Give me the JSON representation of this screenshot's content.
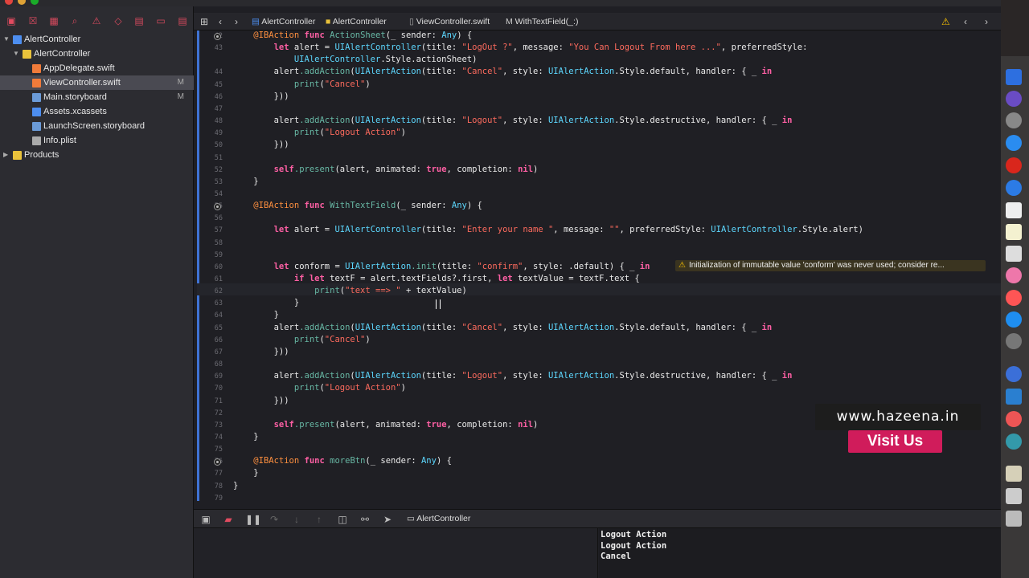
{
  "breadcrumb": [
    "AlertController",
    "AlertController",
    "ViewController.swift",
    "WithTextField(_:)"
  ],
  "navigator": {
    "items": [
      {
        "label": "AlertController",
        "status": "",
        "kind": "project"
      },
      {
        "label": "AlertController",
        "status": "",
        "kind": "folder"
      },
      {
        "label": "AppDelegate.swift",
        "status": "",
        "kind": "swift"
      },
      {
        "label": "ViewController.swift",
        "status": "M",
        "kind": "swift"
      },
      {
        "label": "Main.storyboard",
        "status": "M",
        "kind": "storyboard"
      },
      {
        "label": "Assets.xcassets",
        "status": "",
        "kind": "assets"
      },
      {
        "label": "LaunchScreen.storyboard",
        "status": "",
        "kind": "storyboard"
      },
      {
        "label": "Info.plist",
        "status": "",
        "kind": "plist"
      },
      {
        "label": "Products",
        "status": "",
        "kind": "folder"
      }
    ]
  },
  "editor": {
    "line_numbers": [
      "42",
      "43",
      "",
      "44",
      "45",
      "46",
      "47",
      "48",
      "49",
      "50",
      "51",
      "52",
      "53",
      "54",
      "55",
      "56",
      "57",
      "58",
      "59",
      "60",
      "61",
      "62",
      "63",
      "64",
      "65",
      "66",
      "67",
      "68",
      "69",
      "70",
      "71",
      "72",
      "73",
      "74",
      "75",
      "76",
      "77",
      "78",
      "79"
    ],
    "lines": [
      "    @IBAction func ActionSheet(_ sender: Any) {",
      "        let alert = UIAlertController(title: \"LogOut ?\", message: \"You Can Logout From here ...\", preferredStyle:",
      "            UIAlertController.Style.actionSheet)",
      "        alert.addAction(UIAlertAction(title: \"Cancel\", style: UIAlertAction.Style.default, handler: { _ in",
      "            print(\"Cancel\")",
      "        }))",
      "",
      "        alert.addAction(UIAlertAction(title: \"Logout\", style: UIAlertAction.Style.destructive, handler: { _ in",
      "            print(\"Logout Action\")",
      "        }))",
      "",
      "        self.present(alert, animated: true, completion: nil)",
      "    }",
      "",
      "    @IBAction func WithTextField(_ sender: Any) {",
      "",
      "        let alert = UIAlertController(title: \"Enter your name \", message: \"\", preferredStyle: UIAlertController.Style.alert)",
      "",
      "",
      "        let conform = UIAlertAction.init(title: \"confirm\", style: .default) { _ in",
      "            if let textF = alert.textFields?.first, let textValue = textF.text {",
      "                print(\"text ==> \" + textValue)",
      "            }",
      "        }",
      "        alert.addAction(UIAlertAction(title: \"Cancel\", style: UIAlertAction.Style.default, handler: { _ in",
      "            print(\"Cancel\")",
      "        }))",
      "",
      "        alert.addAction(UIAlertAction(title: \"Logout\", style: UIAlertAction.Style.destructive, handler: { _ in",
      "            print(\"Logout Action\")",
      "        }))",
      "",
      "        self.present(alert, animated: true, completion: nil)",
      "    }",
      "",
      "    @IBAction func moreBtn(_ sender: Any) {",
      "    }",
      "}",
      ""
    ],
    "warning": "Initialization of immutable value 'conform' was never used; consider re..."
  },
  "debug": {
    "scheme": "AlertController"
  },
  "console": {
    "lines": [
      "Logout Action",
      "Logout Action",
      "Cancel"
    ]
  },
  "watermark": {
    "site": "www.hazeena.in",
    "cta": "Visit Us"
  },
  "colors": {
    "keyword": "#fc5fa3",
    "string": "#fc6a5d",
    "type": "#5dd8ff",
    "accent": "#3f73d4",
    "cta": "#d01c5b"
  }
}
